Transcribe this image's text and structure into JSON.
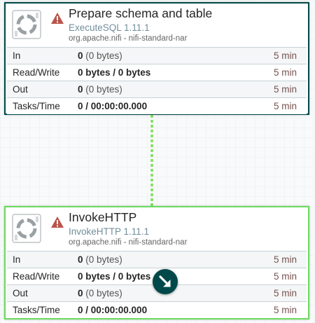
{
  "processors": [
    {
      "name": "Prepare schema and table",
      "type": "ExecuteSQL 1.11.1",
      "bundle": "org.apache.nifi - nifi-standard-nar",
      "icon": "processor-gear-icon",
      "warning_icon": "warning-triangle-icon",
      "stats": [
        {
          "label": "In",
          "value_bold": "0",
          "value_plain": "(0 bytes)",
          "time": "5 min"
        },
        {
          "label": "Read/Write",
          "value_bold": "0 bytes / 0 bytes",
          "value_plain": "",
          "time": "5 min"
        },
        {
          "label": "Out",
          "value_bold": "0",
          "value_plain": "(0 bytes)",
          "time": "5 min"
        },
        {
          "label": "Tasks/Time",
          "value_bold": "0 / 00:00:00.000",
          "value_plain": "",
          "time": "5 min"
        }
      ]
    },
    {
      "name": "InvokeHTTP",
      "type": "InvokeHTTP 1.11.1",
      "bundle": "org.apache.nifi - nifi-standard-nar",
      "icon": "processor-gear-icon",
      "warning_icon": "warning-triangle-icon",
      "stats": [
        {
          "label": "In",
          "value_bold": "0",
          "value_plain": "(0 bytes)",
          "time": "5 min"
        },
        {
          "label": "Read/Write",
          "value_bold": "0 bytes / 0 bytes",
          "value_plain": "",
          "time": "5 min"
        },
        {
          "label": "Out",
          "value_bold": "0",
          "value_plain": "(0 bytes)",
          "time": "5 min"
        },
        {
          "label": "Tasks/Time",
          "value_bold": "0 / 00:00:00.000",
          "value_plain": "",
          "time": "5 min"
        }
      ]
    }
  ],
  "connection": {
    "color": "#7ee05a",
    "style": "dashed"
  },
  "cursor_badge": {
    "icon": "arrow-down-right-icon",
    "color": "#004849"
  },
  "colors": {
    "selected_border": "#004849",
    "running_border": "#6adb5e",
    "type_text": "#728e9b",
    "warning": "#ba554a"
  }
}
